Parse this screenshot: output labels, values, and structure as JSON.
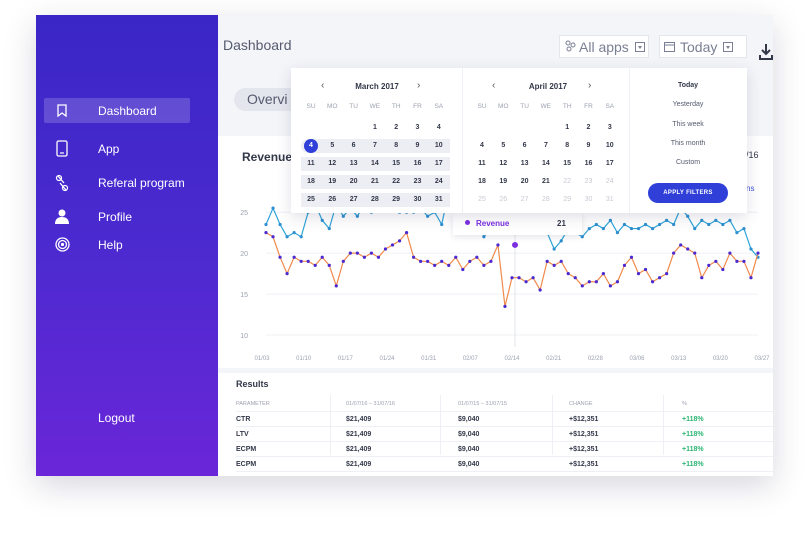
{
  "sidebar": {
    "items": [
      {
        "label": "Dashboard",
        "icon": "bookmark-icon"
      },
      {
        "label": "App",
        "icon": "phone-icon"
      },
      {
        "label": "Referal program",
        "icon": "link-icon"
      },
      {
        "label": "Profile",
        "icon": "user-icon"
      },
      {
        "label": "Help",
        "icon": "target-icon"
      }
    ],
    "logout": "Logout"
  },
  "header": {
    "title": "Dashboard",
    "apps_select": "All apps",
    "date_select": "Today",
    "overview_tab": "Overvi"
  },
  "datepicker": {
    "left": {
      "month": "March 2017",
      "weekdays": [
        "SU",
        "MO",
        "TU",
        "WE",
        "TH",
        "FR",
        "SA"
      ],
      "weeks": [
        [
          "",
          "",
          "",
          "1",
          "2",
          "3",
          "4"
        ],
        [
          "4",
          "5",
          "6",
          "7",
          "8",
          "9",
          "10"
        ],
        [
          "11",
          "12",
          "13",
          "14",
          "15",
          "16",
          "17"
        ],
        [
          "18",
          "19",
          "20",
          "21",
          "22",
          "23",
          "24"
        ],
        [
          "25",
          "26",
          "27",
          "28",
          "29",
          "30",
          "31"
        ]
      ]
    },
    "right": {
      "month": "April 2017",
      "weekdays": [
        "SU",
        "MO",
        "TU",
        "WE",
        "TH",
        "FR",
        "SA"
      ],
      "weeks": [
        [
          "",
          "",
          "",
          "",
          "1",
          "2",
          "3"
        ],
        [
          "4",
          "5",
          "6",
          "7",
          "8",
          "9",
          "10"
        ],
        [
          "11",
          "12",
          "13",
          "14",
          "15",
          "16",
          "17"
        ],
        [
          "18",
          "19",
          "20",
          "21",
          "22",
          "23",
          "24"
        ],
        [
          "25",
          "26",
          "27",
          "28",
          "29",
          "30",
          "31"
        ]
      ]
    },
    "quick_options": [
      "Today",
      "Yesterday",
      "This week",
      "This month",
      "Custom"
    ],
    "apply_label": "APPLY FILTERS"
  },
  "revenue": {
    "title": "Revenue",
    "right_label": "/16",
    "right_link": "ns",
    "tooltip": {
      "label": "Revenue",
      "value": "21"
    }
  },
  "chart_data": {
    "type": "line",
    "x": [
      "01/03",
      "",
      "",
      "",
      "",
      "01/10",
      "",
      "",
      "",
      "",
      "",
      "",
      "01/17",
      "",
      "",
      "",
      "",
      "",
      "",
      "01/24",
      "",
      "",
      "",
      "",
      "",
      "",
      "01/31",
      "",
      "",
      "",
      "",
      "",
      "",
      "02/07",
      "",
      "",
      "",
      "",
      "",
      "",
      "02/14",
      "",
      "",
      "",
      "",
      "",
      "",
      "02/21",
      "",
      "",
      "",
      "",
      "",
      "",
      "02/28",
      "",
      "",
      "",
      "",
      "",
      "",
      "03/06",
      "",
      "",
      "",
      "",
      "",
      "",
      "03/13",
      "",
      "",
      "",
      "",
      "",
      "",
      "03/20",
      "",
      "",
      "",
      "",
      "",
      "",
      "03/27"
    ],
    "x_ticks": [
      "01/03",
      "01/10",
      "01/17",
      "01/24",
      "01/31",
      "02/07",
      "02/14",
      "02/21",
      "02/28",
      "03/06",
      "03/13",
      "03/20",
      "03/27"
    ],
    "y_ticks": [
      10,
      15,
      20,
      25
    ],
    "ylim": [
      10,
      26
    ],
    "series": [
      {
        "color": "#2fa4d8",
        "values": [
          23.5,
          25.5,
          23.5,
          22,
          22.5,
          22,
          25,
          26,
          24,
          23,
          26,
          24.5,
          25.5,
          24.5,
          26,
          25,
          26,
          25.5,
          26,
          25,
          25,
          25,
          25.5,
          24.5,
          25,
          23.5,
          27.5,
          26,
          25,
          25,
          25.5,
          22,
          23,
          23.5,
          24,
          23.5,
          24,
          24,
          23.5,
          24,
          22.5,
          20.5,
          21.5,
          23,
          22.5,
          22,
          23,
          23.5,
          23,
          24,
          22.5,
          23.5,
          23,
          23,
          23.5,
          23,
          23.5,
          24,
          23.5,
          25.5,
          24.5,
          23,
          24,
          23.5,
          24,
          23.5,
          24,
          22.5,
          23,
          20.5,
          19.5
        ]
      },
      {
        "color": "#f08a4b",
        "values": [
          22.5,
          22,
          19.5,
          17.5,
          19.5,
          19,
          19,
          18.5,
          19.5,
          18.5,
          16,
          19,
          20,
          20,
          19.5,
          20,
          19.5,
          20.5,
          21,
          21.5,
          22.5,
          19.5,
          19,
          19,
          18.5,
          19,
          18.5,
          19.5,
          18,
          19,
          19.5,
          18.5,
          19,
          21,
          13.5,
          17,
          17,
          16.5,
          17,
          15.5,
          19,
          18.5,
          19,
          17.5,
          17,
          16,
          16.5,
          16.5,
          17.5,
          16,
          16.5,
          18.5,
          19.5,
          17.5,
          18,
          16.5,
          17,
          17.5,
          20,
          21,
          20.5,
          20,
          17,
          18.5,
          19,
          18,
          20,
          19,
          19,
          17,
          20
        ]
      }
    ]
  },
  "results": {
    "title": "Results",
    "headers": [
      "PARAMETER",
      "01/07/16 – 31/07/16",
      "01/07/15 – 31/07/15",
      "CHANGE",
      "%"
    ],
    "rows": [
      [
        "CTR",
        "$21,409",
        "$9,040",
        "+$12,351",
        "+118%"
      ],
      [
        "LTV",
        "$21,409",
        "$9,040",
        "+$12,351",
        "+118%"
      ],
      [
        "ECPM",
        "$21,409",
        "$9,040",
        "+$12,351",
        "+118%"
      ],
      [
        "ECPM",
        "$21,409",
        "$9,040",
        "+$12,351",
        "+118%"
      ]
    ],
    "positive_color": "#2bb673"
  }
}
